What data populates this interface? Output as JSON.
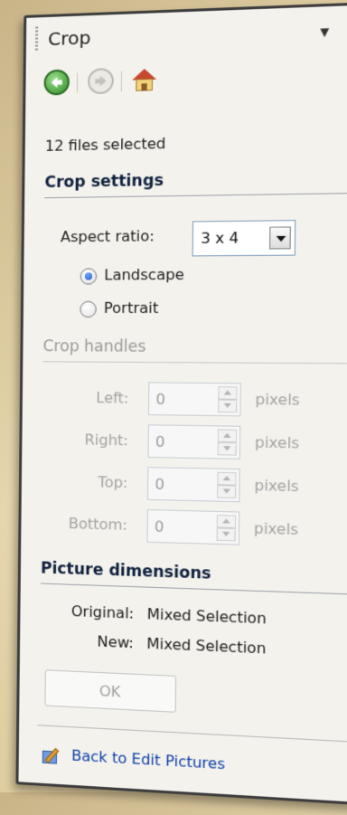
{
  "pane": {
    "title": "Crop",
    "dropdown_icon": "chevron-down-icon",
    "close_label": "×"
  },
  "nav": {
    "back_icon": "back-arrow-icon",
    "forward_icon": "forward-arrow-icon",
    "home_icon": "home-icon"
  },
  "status": "12 files selected",
  "crop_settings": {
    "heading": "Crop settings",
    "aspect_label": "Aspect ratio:",
    "aspect_value": "3 x 4",
    "orientation": [
      {
        "label": "Landscape",
        "selected": true
      },
      {
        "label": "Portrait",
        "selected": false
      }
    ]
  },
  "crop_handles": {
    "heading": "Crop handles",
    "unit": "pixels",
    "fields": [
      {
        "label": "Left:",
        "value": "0"
      },
      {
        "label": "Right:",
        "value": "0"
      },
      {
        "label": "Top:",
        "value": "0"
      },
      {
        "label": "Bottom:",
        "value": "0"
      }
    ]
  },
  "dimensions": {
    "heading": "Picture dimensions",
    "original_label": "Original:",
    "original_value": "Mixed Selection",
    "new_label": "New:",
    "new_value": "Mixed Selection"
  },
  "ok_label": "OK",
  "back_link": "Back to Edit Pictures",
  "colors": {
    "accent": "#0b3fa8",
    "heading": "#12233f",
    "disabled": "#a3a3a3"
  }
}
